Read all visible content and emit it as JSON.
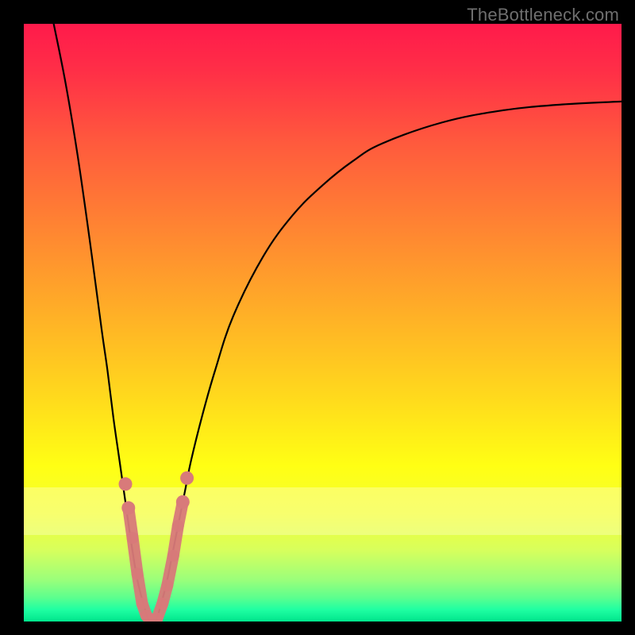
{
  "attribution": "TheBottleneck.com",
  "colors": {
    "frame": "#000000",
    "curve": "#000000",
    "marker": "#d87a7a"
  },
  "chart_data": {
    "type": "line",
    "title": "",
    "xlabel": "",
    "ylabel": "",
    "xlim": [
      0,
      100
    ],
    "ylim": [
      0,
      100
    ],
    "series": [
      {
        "name": "bottleneck-curve",
        "x": [
          5,
          7,
          9,
          11,
          13,
          14,
          15,
          16,
          17,
          18,
          19,
          20,
          21,
          22,
          23,
          24,
          25,
          26,
          27,
          28,
          30,
          32,
          35,
          40,
          45,
          50,
          55,
          60,
          70,
          80,
          90,
          100
        ],
        "y": [
          100,
          90,
          78,
          64,
          49,
          42,
          34,
          27,
          20,
          13,
          7,
          3,
          0,
          0,
          3,
          7,
          12,
          17,
          22,
          27,
          35,
          42,
          51,
          61,
          68,
          73,
          77,
          80,
          83.5,
          85.5,
          86.5,
          87
        ]
      }
    ],
    "markers": {
      "name": "highlighted-points",
      "x": [
        17.5,
        18.2,
        19.0,
        19.8,
        20.5,
        21.3,
        22.3,
        23.2,
        24.0,
        25.0,
        25.8,
        26.6
      ],
      "y": [
        19,
        14,
        8,
        3,
        1,
        0,
        0.5,
        3,
        6,
        11,
        16,
        20
      ]
    }
  }
}
